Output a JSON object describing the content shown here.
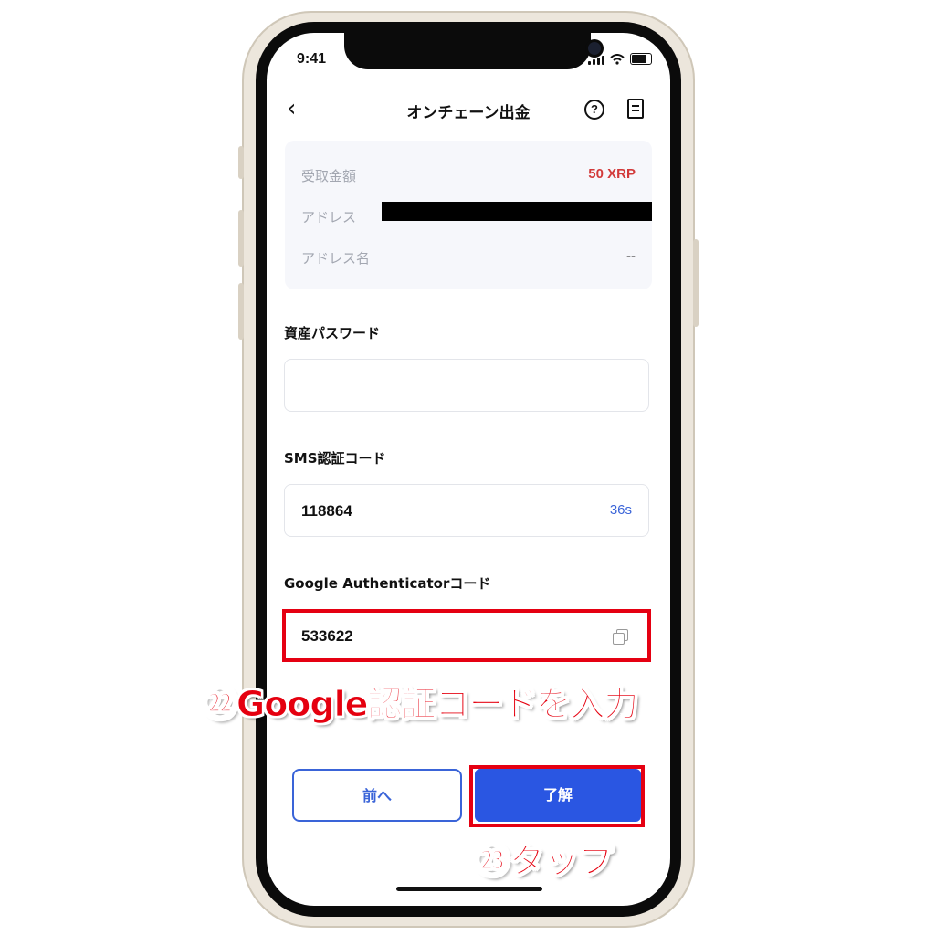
{
  "status_bar": {
    "time": "9:41"
  },
  "header": {
    "title": "オンチェーン出金",
    "back_icon": "chevron-left-icon",
    "help_icon": "question-circle-icon",
    "record_icon": "record-list-icon"
  },
  "summary": {
    "rows": [
      {
        "label": "受取金額",
        "value": "50 XRP",
        "value_color": "#d23a3a"
      },
      {
        "label": "アドレス",
        "value": ""
      },
      {
        "label": "アドレス名",
        "value": "--",
        "value_color": "#555555"
      }
    ]
  },
  "asset_password": {
    "label": "資産パスワード",
    "value": ""
  },
  "sms": {
    "label": "SMS認証コード",
    "value": "118864",
    "timer": "36s"
  },
  "google": {
    "label": "Google Authenticatorコード",
    "value": "533622"
  },
  "buttons": {
    "prev": "前へ",
    "confirm": "了解"
  },
  "annotations": {
    "step22": "㉒Google認証コードを入力",
    "step23": "㉓タップ",
    "highlight_color": "#e50012"
  }
}
